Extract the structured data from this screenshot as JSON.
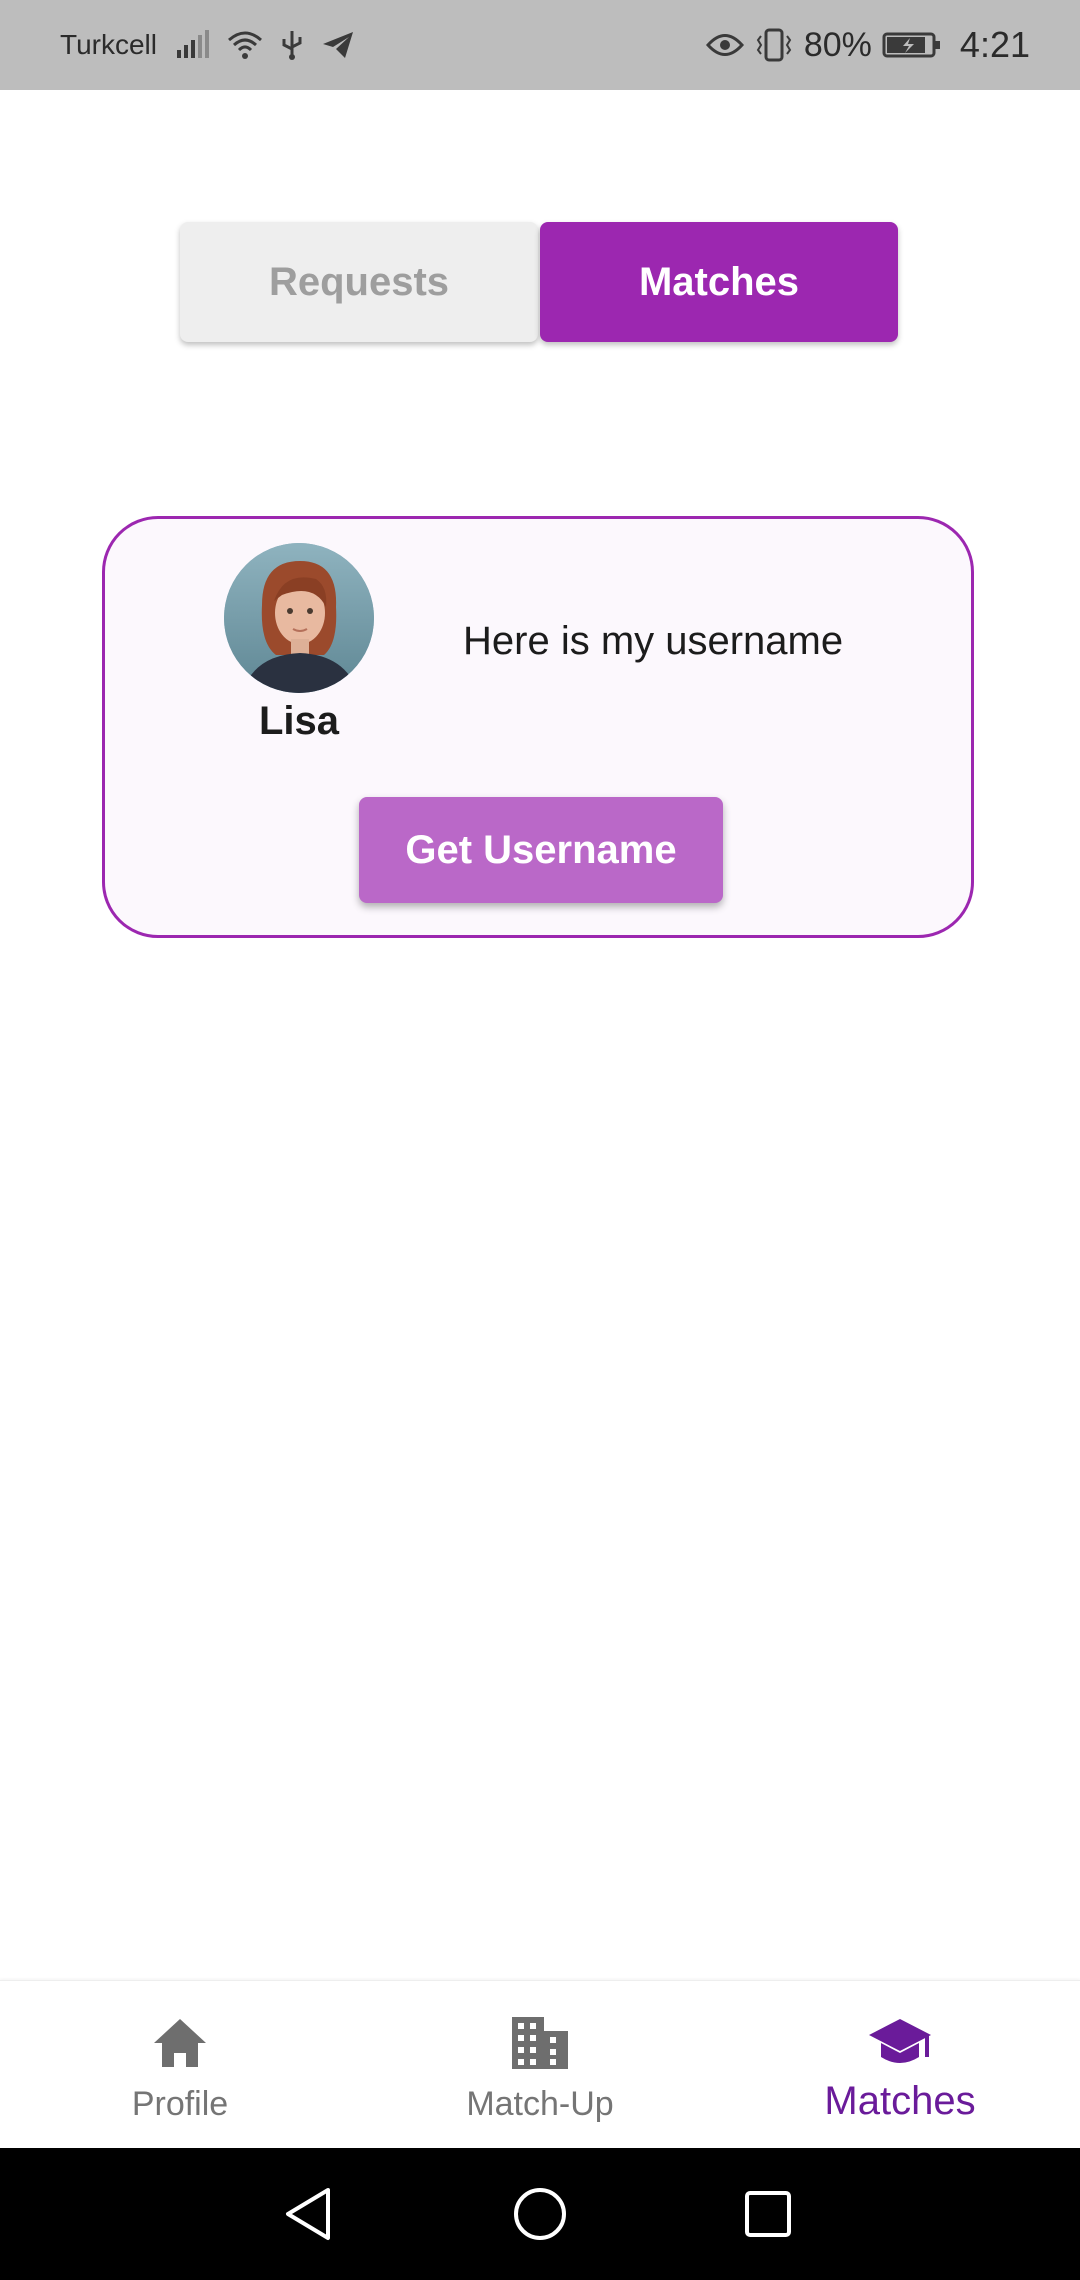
{
  "status_bar": {
    "carrier": "Turkcell",
    "battery": "80%",
    "time": "4:21",
    "icons": [
      "signal-icon",
      "wifi-icon",
      "usb-icon",
      "telegram-icon",
      "eye-icon",
      "vibrate-icon",
      "battery-icon"
    ]
  },
  "tabs": {
    "requests_label": "Requests",
    "matches_label": "Matches",
    "active": "Matches"
  },
  "match_card": {
    "name": "Lisa",
    "message": "Here is my username",
    "button_label": "Get Username"
  },
  "bottom_nav": {
    "items": [
      {
        "label": "Profile",
        "icon": "home-icon"
      },
      {
        "label": "Match-Up",
        "icon": "building-icon"
      },
      {
        "label": "Matches",
        "icon": "graduation-cap-icon",
        "active": true
      }
    ]
  },
  "colors": {
    "accent": "#9c27b0",
    "accent_light": "#ba68c8",
    "active_nav": "#6a1b9a",
    "status_bar": "#bdbdbd"
  }
}
